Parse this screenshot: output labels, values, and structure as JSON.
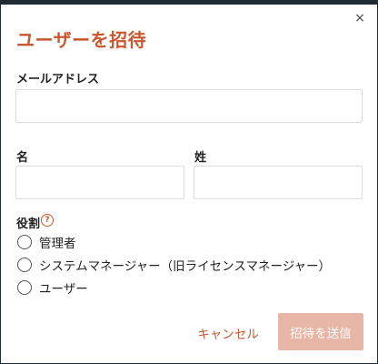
{
  "dialog": {
    "title": "ユーザーを招待",
    "close_icon": "×"
  },
  "form": {
    "email": {
      "label": "メールアドレス",
      "value": "",
      "placeholder": ""
    },
    "first_name": {
      "label": "名",
      "value": "",
      "placeholder": ""
    },
    "last_name": {
      "label": "姓",
      "value": "",
      "placeholder": ""
    },
    "role": {
      "label": "役割",
      "help_icon": "?",
      "options": [
        {
          "label": "管理者",
          "selected": false
        },
        {
          "label": "システムマネージャー（旧ライセンスマネージャー）",
          "selected": false
        },
        {
          "label": "ユーザー",
          "selected": false
        }
      ]
    }
  },
  "actions": {
    "cancel_label": "キャンセル",
    "submit_label": "招待を送信",
    "submit_disabled": true
  },
  "colors": {
    "accent": "#c9572e",
    "submit_disabled_bg": "#e8b6a7",
    "input_border": "#d8dbe0"
  }
}
